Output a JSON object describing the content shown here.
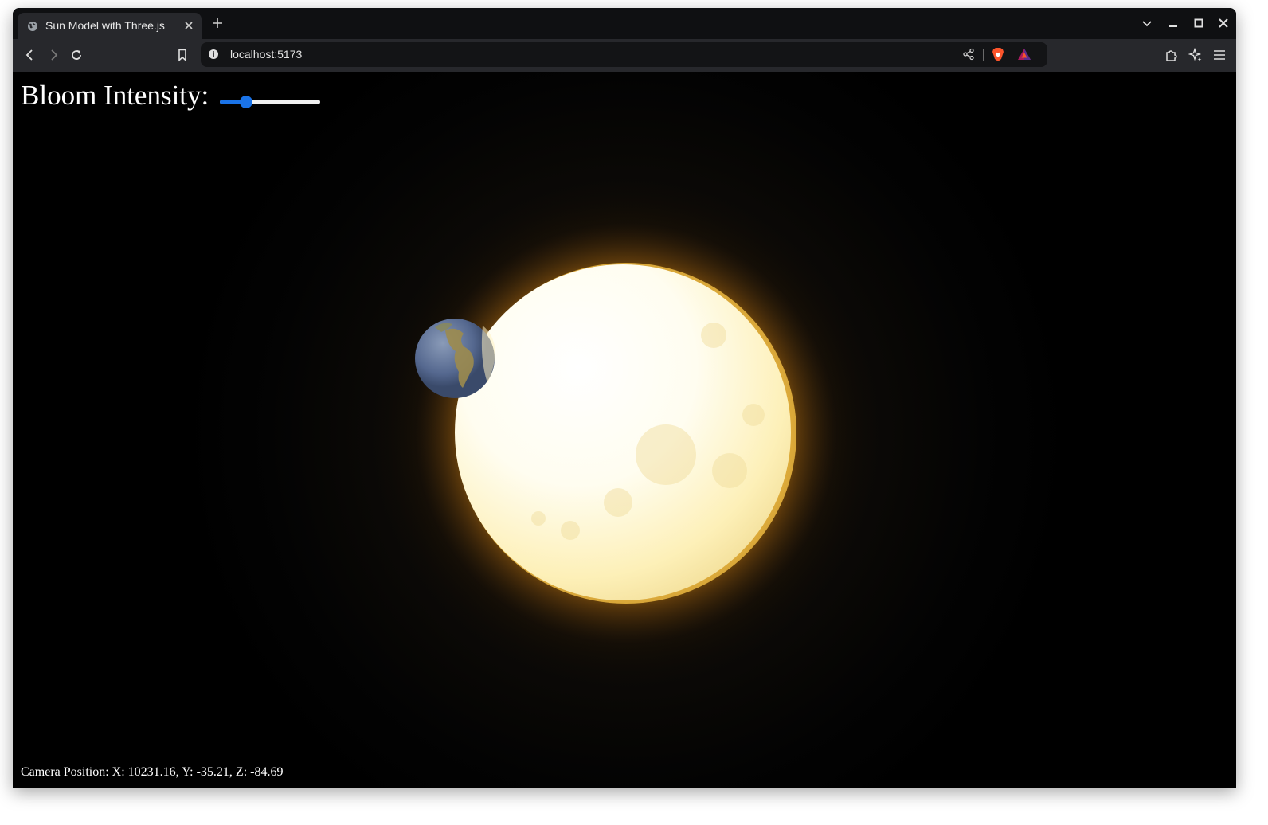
{
  "browser": {
    "tab": {
      "title": "Sun Model with Three.js",
      "favicon": "globe-icon"
    },
    "address_bar": {
      "url": "localhost:5173",
      "site_info_icon": "info-icon"
    },
    "toolbar_icons": [
      "back-icon",
      "forward-icon",
      "reload-icon",
      "bookmark-icon",
      "share-icon",
      "brave-shields-icon",
      "brave-rewards-icon",
      "extensions-icon",
      "leo-ai-icon",
      "menu-icon"
    ],
    "window_controls": [
      "tab-search-icon",
      "minimize-icon",
      "maximize-icon",
      "close-icon"
    ]
  },
  "page": {
    "bloom": {
      "label": "Bloom Intensity:",
      "value_fraction": 0.26
    },
    "camera_position": "Camera Position: X: 10231.16, Y: -35.21, Z: -84.69",
    "colors": {
      "background": "#000000",
      "sun_core": "#fffbe8",
      "sun_glow": "#ffb300",
      "slider_accent": "#1a73e8"
    }
  }
}
